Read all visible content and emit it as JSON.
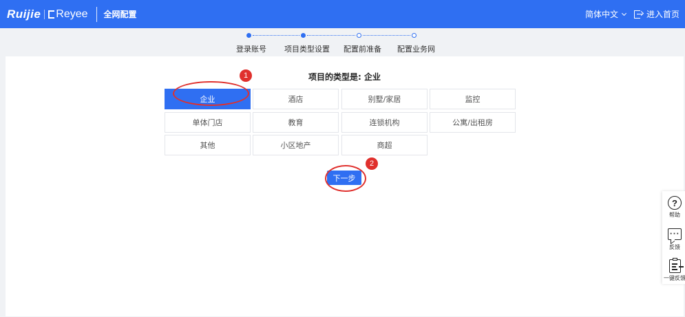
{
  "header": {
    "brand": "Ruijie",
    "sub_brand": "Reyee",
    "title": "全网配置",
    "language": "简体中文",
    "enter_home": "进入首页"
  },
  "steps": [
    {
      "label": "登录账号",
      "state": "done"
    },
    {
      "label": "项目类型设置",
      "state": "current"
    },
    {
      "label": "配置前准备",
      "state": "todo"
    },
    {
      "label": "配置业务网",
      "state": "todo"
    }
  ],
  "panel": {
    "title": "项目的类型是: 企业",
    "types": [
      {
        "label": "企业",
        "selected": true
      },
      {
        "label": "酒店",
        "selected": false
      },
      {
        "label": "别墅/家居",
        "selected": false
      },
      {
        "label": "监控",
        "selected": false
      },
      {
        "label": "单体门店",
        "selected": false
      },
      {
        "label": "教育",
        "selected": false
      },
      {
        "label": "连锁机构",
        "selected": false
      },
      {
        "label": "公寓/出租房",
        "selected": false
      },
      {
        "label": "其他",
        "selected": false
      },
      {
        "label": "小区地产",
        "selected": false
      },
      {
        "label": "商超",
        "selected": false
      }
    ],
    "next_label": "下一步"
  },
  "annotations": [
    {
      "number": "1"
    },
    {
      "number": "2"
    }
  ],
  "side_toolbar": [
    {
      "label": "帮助",
      "icon": "help-icon"
    },
    {
      "label": "反馈",
      "icon": "chat-icon"
    },
    {
      "label": "一键反馈",
      "icon": "clipboard-icon"
    }
  ],
  "colors": {
    "primary": "#2f6ff2",
    "annotation": "#e0302d",
    "background": "#f0f2f5"
  }
}
